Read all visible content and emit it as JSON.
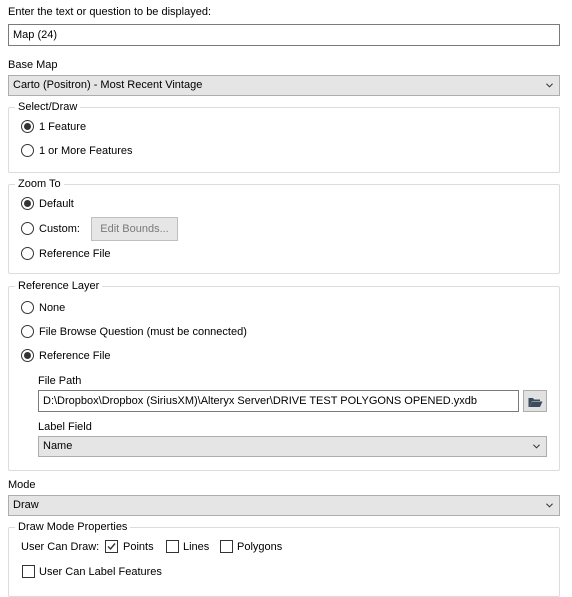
{
  "question_prompt": "Enter the text or question to be displayed:",
  "question_value": "Map (24)",
  "base_map": {
    "label": "Base Map",
    "selected": "Carto (Positron) - Most Recent Vintage"
  },
  "select_draw": {
    "title": "Select/Draw",
    "options": [
      "1 Feature",
      "1 or More Features"
    ],
    "selected_index": 0
  },
  "zoom_to": {
    "title": "Zoom To",
    "default_label": "Default",
    "custom_label": "Custom:",
    "edit_bounds_label": "Edit Bounds...",
    "reference_file_label": "Reference File",
    "selected": "Default"
  },
  "reference_layer": {
    "title": "Reference Layer",
    "none_label": "None",
    "file_browse_label": "File Browse Question (must be connected)",
    "reference_file_label": "Reference File",
    "selected": "Reference File",
    "file_path_label": "File Path",
    "file_path_value": "D:\\Dropbox\\Dropbox (SiriusXM)\\Alteryx Server\\DRIVE TEST POLYGONS OPENED.yxdb",
    "label_field_label": "Label Field",
    "label_field_value": "Name"
  },
  "mode": {
    "label": "Mode",
    "selected": "Draw"
  },
  "draw_mode_properties": {
    "title": "Draw Mode Properties",
    "user_can_draw_label": "User Can Draw:",
    "points_label": "Points",
    "points_checked": true,
    "lines_label": "Lines",
    "lines_checked": false,
    "polygons_label": "Polygons",
    "polygons_checked": false,
    "user_can_label_features_label": "User Can Label Features",
    "user_can_label_features_checked": false
  },
  "colors": {
    "folder_icon": "#3c4b5c",
    "combo_bg": "#e5e5e5",
    "group_border": "#dcdcdc"
  }
}
